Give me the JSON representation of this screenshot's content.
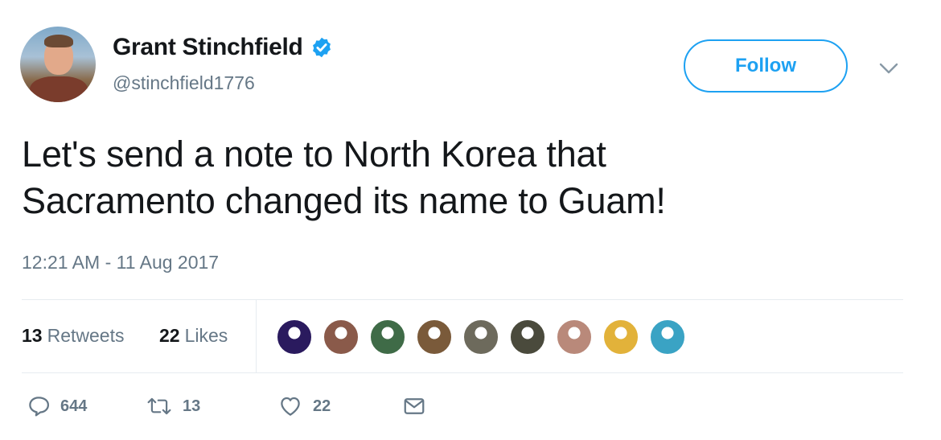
{
  "user": {
    "name": "Grant Stinchfield",
    "handle": "@stinchfield1776"
  },
  "follow_label": "Follow",
  "tweet": {
    "lines": [
      "Let's send a note to North Korea that",
      "Sacramento changed its name to Guam!"
    ],
    "timestamp": "12:21 AM - 11 Aug 2017"
  },
  "stats": {
    "retweets_count": "13",
    "retweets_label": "Retweets",
    "likes_count": "22",
    "likes_label": "Likes"
  },
  "liker_colors": [
    "#2a1a5e",
    "#8a5a4a",
    "#3f6b47",
    "#7a5a3a",
    "#6d6a5c",
    "#4a4a3c",
    "#b9897a",
    "#e2b23a",
    "#3aa3c4"
  ],
  "actions": {
    "reply_count": "644",
    "retweet_count": "13",
    "like_count": "22"
  },
  "colors": {
    "accent": "#1da1f2",
    "secondary_text": "#657786",
    "primary_text": "#14171a",
    "divider": "#e6ecf0"
  },
  "icons": [
    "verified-badge-icon",
    "chevron-down-icon",
    "reply-icon",
    "retweet-icon",
    "heart-icon",
    "envelope-icon"
  ]
}
